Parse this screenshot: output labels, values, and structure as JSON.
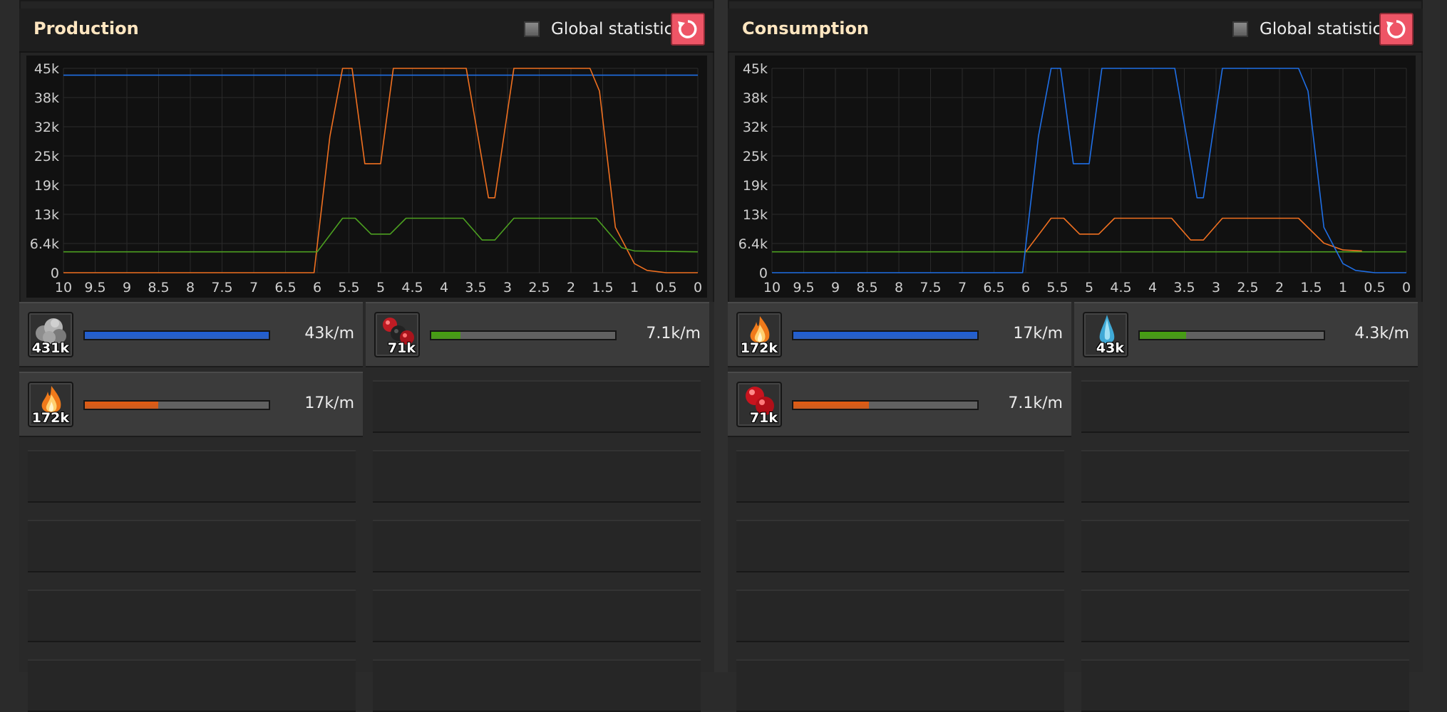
{
  "production": {
    "title": "Production",
    "global_label": "Global statistics",
    "items": [
      {
        "icon": "coal-icon",
        "count": "431k",
        "rate": "43k/m",
        "fill": 1.0,
        "color": "#1f5fd6"
      },
      {
        "icon": "oil-pellets-icon",
        "count": "71k",
        "rate": "7.1k/m",
        "fill": 0.16,
        "color": "#45a10f"
      },
      {
        "icon": "fire-icon",
        "count": "172k",
        "rate": "17k/m",
        "fill": 0.4,
        "color": "#e35b11"
      }
    ]
  },
  "consumption": {
    "title": "Consumption",
    "global_label": "Global statistics",
    "items": [
      {
        "icon": "fire-icon",
        "count": "172k",
        "rate": "17k/m",
        "fill": 1.0,
        "color": "#1f5fd6"
      },
      {
        "icon": "water-drop-icon",
        "count": "43k",
        "rate": "4.3k/m",
        "fill": 0.25,
        "color": "#45a10f"
      },
      {
        "icon": "red-pellets-icon",
        "count": "71k",
        "rate": "7.1k/m",
        "fill": 0.41,
        "color": "#e35b11"
      }
    ]
  },
  "chart_data": [
    {
      "type": "line",
      "y_ticks": [
        "0",
        "6.4k",
        "13k",
        "19k",
        "25k",
        "32k",
        "38k",
        "45k"
      ],
      "x_ticks": [
        "10",
        "9.5",
        "9",
        "8.5",
        "8",
        "7.5",
        "7",
        "6.5",
        "6",
        "5.5",
        "5",
        "4.5",
        "4",
        "3.5",
        "3",
        "2.5",
        "2",
        "1.5",
        "1",
        "0.5",
        "0"
      ],
      "xlim": [
        10,
        0
      ],
      "ylim": [
        0,
        45000
      ],
      "grid": true,
      "series": [
        {
          "color": "#1f6fe6",
          "x": [
            10,
            0
          ],
          "y": [
            43500,
            43500
          ]
        },
        {
          "color": "#f07020",
          "x": [
            10,
            6.05,
            5.8,
            5.6,
            5.45,
            5.25,
            5.0,
            4.8,
            4.6,
            3.65,
            3.3,
            3.2,
            2.9,
            1.7,
            1.55,
            1.3,
            1.0,
            0.8,
            0.5,
            0.2,
            0
          ],
          "y": [
            0,
            0,
            30000,
            45000,
            45000,
            24000,
            24000,
            45000,
            45000,
            45000,
            16500,
            16500,
            45000,
            45000,
            40000,
            10000,
            2000,
            500,
            0,
            0,
            0
          ]
        },
        {
          "color": "#4ca020",
          "x": [
            10,
            6.0,
            5.6,
            5.4,
            5.15,
            4.85,
            4.6,
            3.7,
            3.4,
            3.2,
            2.9,
            1.6,
            1.2,
            1.0,
            0
          ],
          "y": [
            4600,
            4600,
            12000,
            12000,
            8500,
            8500,
            12000,
            12000,
            7200,
            7200,
            12000,
            12000,
            5500,
            4800,
            4600
          ]
        }
      ]
    },
    {
      "type": "line",
      "y_ticks": [
        "0",
        "6.4k",
        "13k",
        "19k",
        "25k",
        "32k",
        "38k",
        "45k"
      ],
      "x_ticks": [
        "10",
        "9.5",
        "9",
        "8.5",
        "8",
        "7.5",
        "7",
        "6.5",
        "6",
        "5.5",
        "5",
        "4.5",
        "4",
        "3.5",
        "3",
        "2.5",
        "2",
        "1.5",
        "1",
        "0.5",
        "0"
      ],
      "xlim": [
        10,
        0
      ],
      "ylim": [
        0,
        45000
      ],
      "grid": true,
      "series": [
        {
          "color": "#4ca020",
          "x": [
            10,
            0
          ],
          "y": [
            4600,
            4600
          ]
        },
        {
          "color": "#f07020",
          "x": [
            6.0,
            5.6,
            5.4,
            5.15,
            4.85,
            4.6,
            3.7,
            3.4,
            3.2,
            2.9,
            1.7,
            1.3,
            1.0,
            0.7
          ],
          "y": [
            4600,
            12000,
            12000,
            8500,
            8500,
            12000,
            12000,
            7200,
            7200,
            12000,
            12000,
            6500,
            5000,
            4800
          ]
        },
        {
          "color": "#1f6fe6",
          "x": [
            10,
            6.05,
            5.8,
            5.6,
            5.45,
            5.25,
            5.0,
            4.8,
            4.6,
            3.65,
            3.3,
            3.2,
            2.9,
            1.7,
            1.55,
            1.3,
            1.0,
            0.8,
            0.5,
            0.2,
            0
          ],
          "y": [
            0,
            0,
            30000,
            45000,
            45000,
            24000,
            24000,
            45000,
            45000,
            45000,
            16500,
            16500,
            45000,
            45000,
            40000,
            10000,
            2000,
            500,
            0,
            0,
            0
          ]
        }
      ]
    }
  ]
}
